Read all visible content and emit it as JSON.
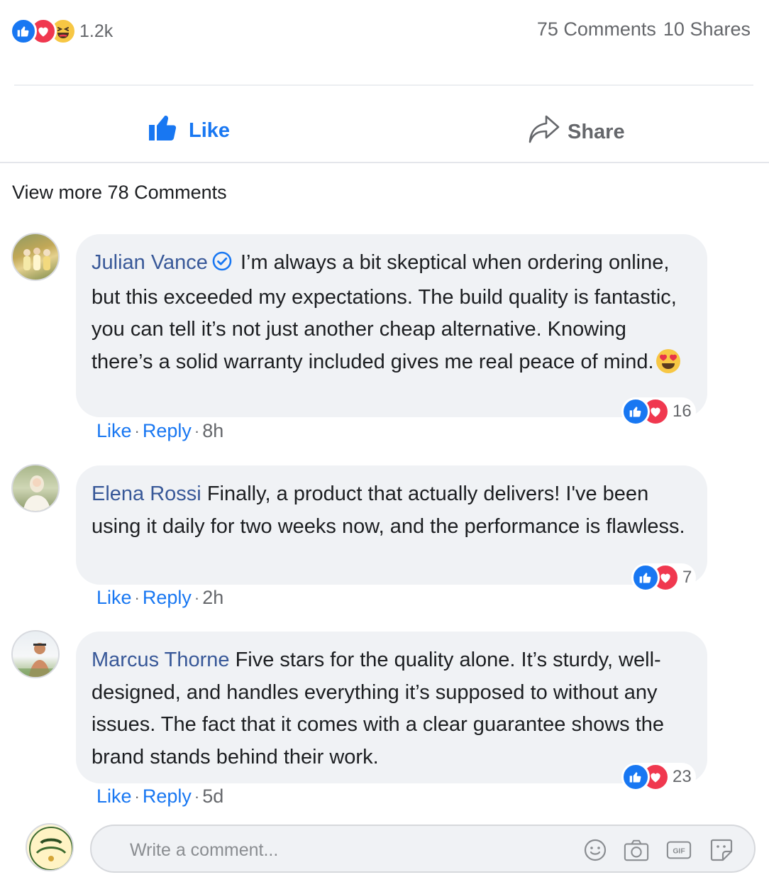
{
  "stats": {
    "reaction_icons": [
      "like-icon",
      "love-icon",
      "haha-icon"
    ],
    "reaction_count": "1.2k",
    "comments": "75 Comments",
    "shares": "10 Shares"
  },
  "actions": {
    "like_label": "Like",
    "share_label": "Share"
  },
  "view_more": "View more 78 Comments",
  "comments": [
    {
      "author": "Julian Vance",
      "verified": true,
      "text": "I’m always a bit skeptical when ordering online, but this exceeded my expectations. The build quality is fantastic, you can tell it’s not just another cheap alternative. Knowing there’s a solid warranty included gives me real peace of mind.",
      "trailing_emoji": "heart-eyes-emoji",
      "reactions": "16",
      "like": "Like",
      "reply": "Reply",
      "time": "8h"
    },
    {
      "author": "Elena Rossi",
      "verified": false,
      "text": "Finally, a product that actually delivers! I've been using it daily for two weeks now, and the performance is flawless.",
      "reactions": "7",
      "like": "Like",
      "reply": "Reply",
      "time": "2h"
    },
    {
      "author": "Marcus Thorne",
      "verified": false,
      "text": "Five stars for the quality alone. It’s sturdy, well-designed, and handles everything it’s supposed to without any issues. The fact that it comes with a clear guarantee shows the brand stands behind their work.",
      "reactions": "23",
      "like": "Like",
      "reply": "Reply",
      "time": "5d"
    }
  ],
  "composer": {
    "placeholder": "Write a comment...",
    "tools": [
      "emoji-icon",
      "camera-icon",
      "gif-icon",
      "sticker-icon"
    ]
  },
  "colors": {
    "accent": "#1877f2",
    "author": "#385898",
    "bubble": "#f0f2f5",
    "love": "#f0384f",
    "haha": "#f7c744",
    "muted": "#65676b"
  }
}
